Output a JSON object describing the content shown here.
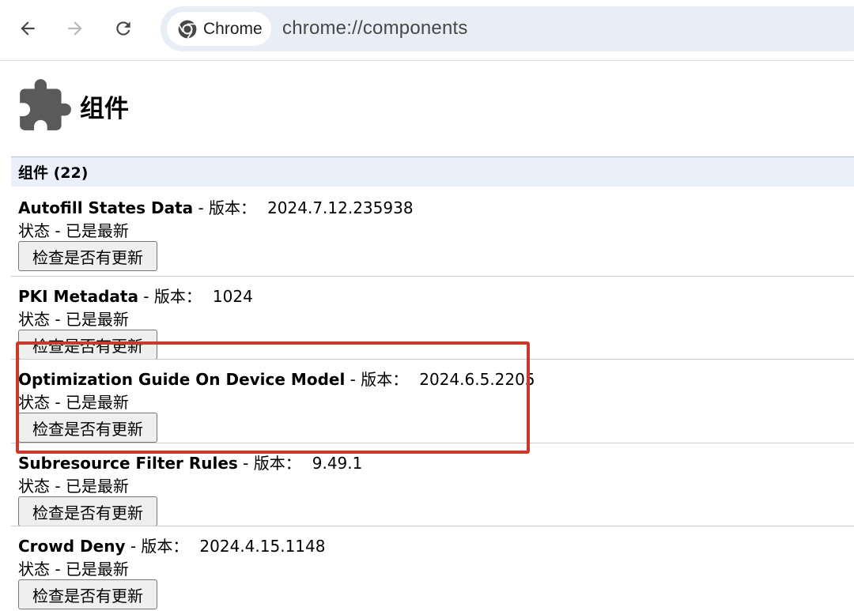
{
  "browser": {
    "back_label": "Back",
    "forward_label": "Forward",
    "reload_label": "Reload",
    "chip_label": "Chrome",
    "url": "chrome://components"
  },
  "page": {
    "title": "组件",
    "section_header": "组件 (22)"
  },
  "components": [
    {
      "name": "Autofill States Data",
      "version_label": " - 版本：",
      "version": "2024.7.12.235938",
      "status": "状态 - 已是最新",
      "button": "检查是否有更新"
    },
    {
      "name": "PKI Metadata",
      "version_label": " - 版本：",
      "version": "1024",
      "status": "状态 - 已是最新",
      "button": "检查是否有更新"
    },
    {
      "name": "Optimization Guide On Device Model",
      "version_label": " - 版本：",
      "version": "2024.6.5.2205",
      "status": "状态 - 已是最新",
      "button": "检查是否有更新"
    },
    {
      "name": "Subresource Filter Rules",
      "version_label": " - 版本：",
      "version": "9.49.1",
      "status": "状态 - 已是最新",
      "button": "检查是否有更新"
    },
    {
      "name": "Crowd Deny",
      "version_label": " - 版本：",
      "version": "2024.4.15.1148",
      "status": "状态 - 已是最新",
      "button": "检查是否有更新"
    }
  ],
  "colors": {
    "highlight_border": "#c83b2c",
    "section_header_bg": "#ebeff9",
    "omnibox_bg": "#e9eef6"
  },
  "icons": [
    "back-arrow-icon",
    "forward-arrow-icon",
    "reload-icon",
    "chrome-logo-icon",
    "puzzle-piece-icon"
  ]
}
